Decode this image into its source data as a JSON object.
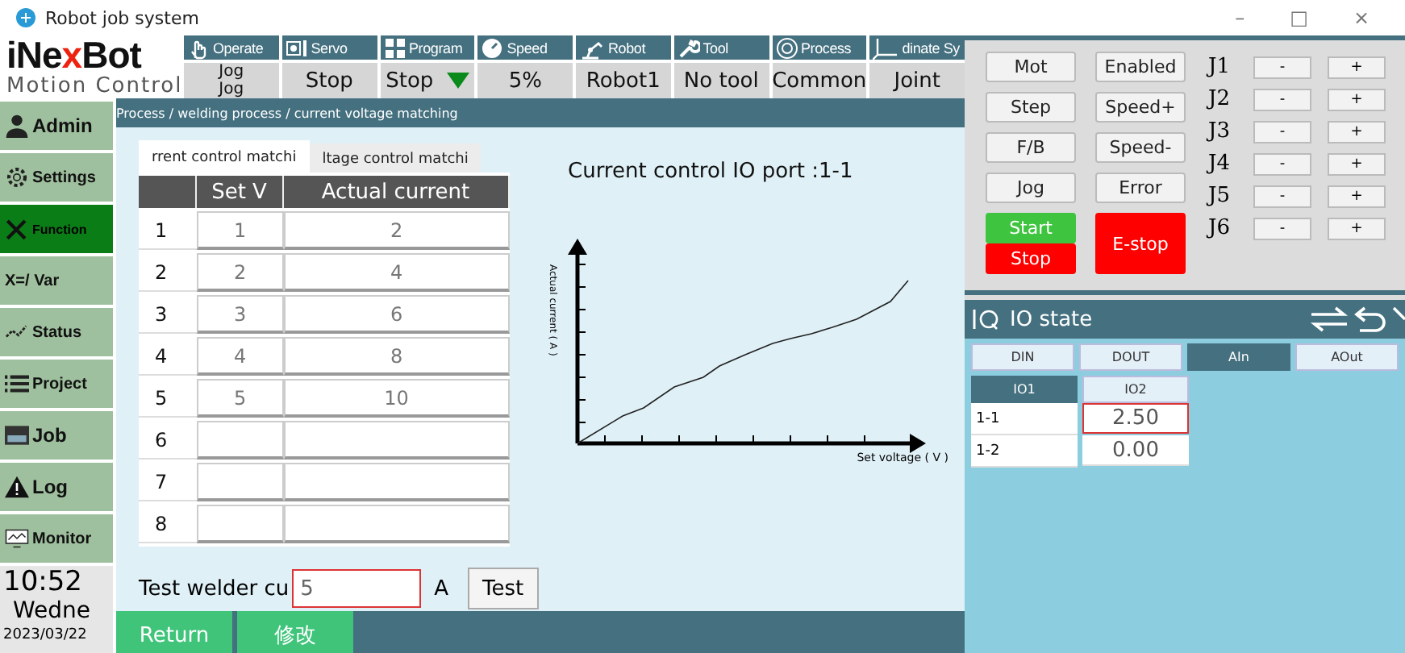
{
  "window": {
    "title": "Robot job system",
    "controls": [
      "–",
      "□",
      "×"
    ]
  },
  "logo": {
    "brand_parts": [
      "iNe",
      "x",
      "Bot"
    ],
    "subtitle": "Motion Control"
  },
  "toolbar": [
    {
      "label": "Operate",
      "values": [
        "Jog",
        "Jog"
      ],
      "dropdown": false
    },
    {
      "label": "Servo",
      "values": [
        "Stop"
      ],
      "dropdown": false
    },
    {
      "label": "Program",
      "values": [
        "Stop"
      ],
      "dropdown": true
    },
    {
      "label": "Speed",
      "values": [
        "5%"
      ],
      "dropdown": false
    },
    {
      "label": "Robot",
      "values": [
        "Robot1"
      ],
      "dropdown": false
    },
    {
      "label": "Tool",
      "values": [
        "No tool"
      ],
      "dropdown": false
    },
    {
      "label": "Process",
      "values": [
        "Common"
      ],
      "dropdown": false
    },
    {
      "label": "dinate Sy",
      "values": [
        "Joint"
      ],
      "dropdown": false
    }
  ],
  "sidebar": {
    "items": [
      {
        "label": "Admin",
        "selected": false
      },
      {
        "label": "Settings",
        "selected": false
      },
      {
        "label": "Function",
        "selected": true
      },
      {
        "label": "X=/ Var",
        "selected": false
      },
      {
        "label": "Status",
        "selected": false
      },
      {
        "label": "Project",
        "selected": false
      },
      {
        "label": "Job",
        "selected": false
      },
      {
        "label": "Log",
        "selected": false
      },
      {
        "label": "Monitor",
        "selected": false
      }
    ],
    "clock": {
      "time": "10:52",
      "day": "Wedne",
      "date": "2023/03/22"
    }
  },
  "breadcrumb": "Process / welding process / current voltage matching",
  "tabs": [
    {
      "label": "rrent control matchi",
      "selected": true
    },
    {
      "label": "ltage control matchi",
      "selected": false
    }
  ],
  "table": {
    "columns": [
      "Set V",
      "Actual current"
    ],
    "rows": [
      {
        "index": "1",
        "set_v": "1",
        "actual": "2"
      },
      {
        "index": "2",
        "set_v": "2",
        "actual": "4"
      },
      {
        "index": "3",
        "set_v": "3",
        "actual": "6"
      },
      {
        "index": "4",
        "set_v": "4",
        "actual": "8"
      },
      {
        "index": "5",
        "set_v": "5",
        "actual": "10"
      },
      {
        "index": "6",
        "set_v": "",
        "actual": ""
      },
      {
        "index": "7",
        "set_v": "",
        "actual": ""
      },
      {
        "index": "8",
        "set_v": "",
        "actual": ""
      }
    ]
  },
  "chart": {
    "title": "Current control IO port :1-1",
    "ylabel": "Actual current ( A )",
    "xlabel": "Set voltage ( V )"
  },
  "test": {
    "label": "Test welder cu",
    "value": "5",
    "highlighted": true,
    "unit": "A",
    "button": "Test"
  },
  "bottom_buttons": [
    "Return",
    "修改"
  ],
  "controls": [
    {
      "label": "Mot",
      "kind": "normal"
    },
    {
      "label": "Enabled",
      "kind": "normal"
    },
    {
      "label": "Step",
      "kind": "normal"
    },
    {
      "label": "Speed+",
      "kind": "normal"
    },
    {
      "label": "F/B",
      "kind": "normal"
    },
    {
      "label": "Speed-",
      "kind": "normal"
    },
    {
      "label": "Jog",
      "kind": "normal"
    },
    {
      "label": "Error",
      "kind": "normal"
    },
    {
      "label": "Start",
      "kind": "start"
    },
    {
      "label": "E-stop",
      "kind": "estop"
    },
    {
      "label": "Stop",
      "kind": "stop"
    }
  ],
  "joints": [
    {
      "label": "J1",
      "minus": "-",
      "plus": "+"
    },
    {
      "label": "J2",
      "minus": "-",
      "plus": "+"
    },
    {
      "label": "J3",
      "minus": "-",
      "plus": "+"
    },
    {
      "label": "J4",
      "minus": "-",
      "plus": "+"
    },
    {
      "label": "J5",
      "minus": "-",
      "plus": "+"
    },
    {
      "label": "J6",
      "minus": "-",
      "plus": "+"
    }
  ],
  "io": {
    "title": "IO state",
    "tabs": [
      {
        "label": "DIN",
        "selected": false
      },
      {
        "label": "DOUT",
        "selected": false
      },
      {
        "label": "AIn",
        "selected": true
      },
      {
        "label": "AOut",
        "selected": false
      }
    ],
    "subtabs": [
      {
        "label": "IO1",
        "selected": true
      },
      {
        "label": "IO2",
        "selected": false
      }
    ],
    "rows": [
      {
        "port": "1-1",
        "value": "2.50",
        "highlighted": true
      },
      {
        "port": "1-2",
        "value": "0.00",
        "highlighted": false
      }
    ]
  }
}
